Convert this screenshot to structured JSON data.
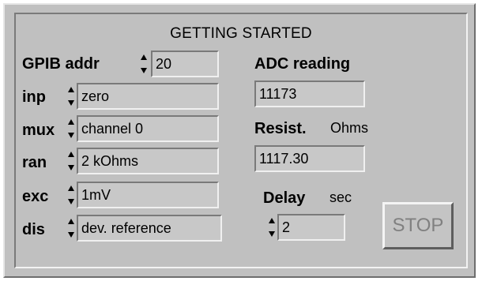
{
  "panel": {
    "title": "GETTING STARTED"
  },
  "gpib": {
    "label": "GPIB addr",
    "value": "20"
  },
  "inputs": [
    {
      "label": "inp",
      "value": "zero"
    },
    {
      "label": "mux",
      "value": "channel 0"
    },
    {
      "label": "ran",
      "value": "2 kOhms"
    },
    {
      "label": "exc",
      "value": "1mV"
    },
    {
      "label": "dis",
      "value": "dev. reference"
    }
  ],
  "adc": {
    "label": "ADC reading",
    "value": "11173"
  },
  "resist": {
    "label": "Resist.",
    "unit": "Ohms",
    "value": "1117.30"
  },
  "delay": {
    "label": "Delay",
    "unit": "sec",
    "value": "2"
  },
  "stop": {
    "label": "STOP"
  },
  "colors": {
    "panel": "#c0c0c0",
    "field": "#c8c8c8",
    "stop_text": "#808080"
  }
}
